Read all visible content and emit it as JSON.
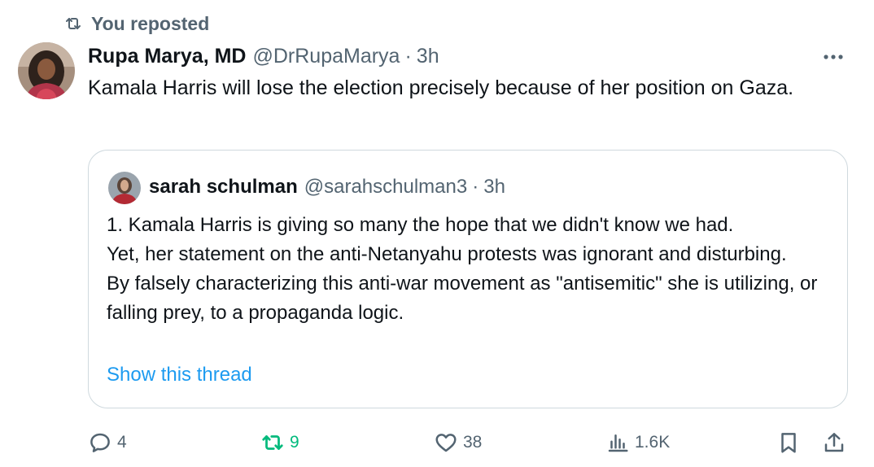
{
  "repost_banner": {
    "label": "You reposted"
  },
  "tweet": {
    "author_name": "Rupa Marya, MD",
    "handle": "@DrRupaMarya",
    "separator": "·",
    "time": "3h",
    "text": "Kamala Harris will lose the election precisely because of her position on Gaza."
  },
  "quote": {
    "author_name": "sarah schulman",
    "handle": "@sarahschulman3",
    "separator": "·",
    "time": "3h",
    "lines": [
      "1. Kamala Harris is giving so many the hope that we didn't know we had.",
      "Yet, her statement on the anti-Netanyahu protests was ignorant and disturbing.",
      "By falsely characterizing this anti-war movement as \"antisemitic\" she is utilizing, or falling prey, to a propaganda logic."
    ],
    "show_thread": "Show this thread"
  },
  "actions": {
    "reply_count": "4",
    "repost_count": "9",
    "like_count": "38",
    "views_count": "1.6K"
  },
  "colors": {
    "text": "#0f1419",
    "secondary": "#536471",
    "link": "#1d9bf0",
    "repost_active": "#00ba7c",
    "border": "#cfd9de"
  },
  "icons": [
    "repost-icon",
    "more-icon",
    "reply-icon",
    "repost-icon",
    "like-icon",
    "views-icon",
    "bookmark-icon",
    "share-icon"
  ]
}
